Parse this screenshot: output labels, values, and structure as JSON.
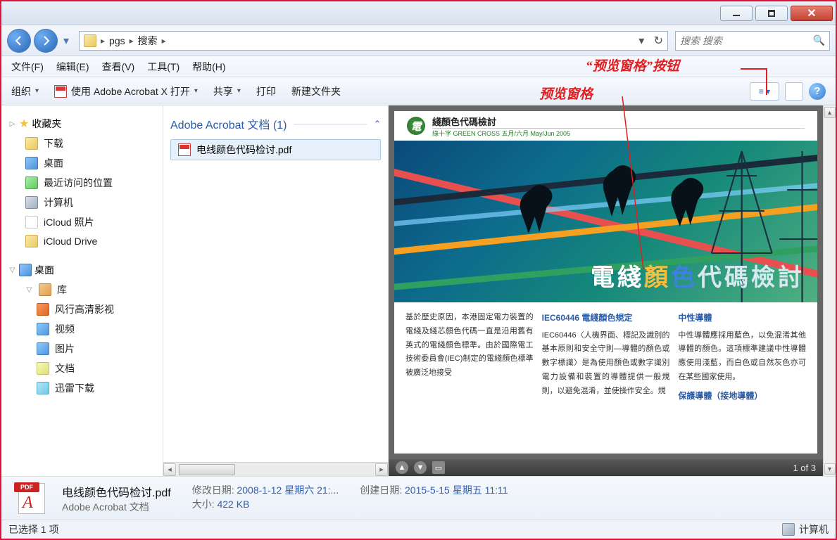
{
  "window_controls": {
    "minimize": "–",
    "maximize": "□",
    "close": "X"
  },
  "address": {
    "segments": [
      "pgs",
      "搜索"
    ]
  },
  "search": {
    "placeholder": "搜索 搜索"
  },
  "menubar": [
    "文件(F)",
    "编辑(E)",
    "查看(V)",
    "工具(T)",
    "帮助(H)"
  ],
  "toolbar": {
    "organize": "组织",
    "open_with": "使用 Adobe Acrobat X 打开",
    "share": "共享",
    "print": "打印",
    "new_folder": "新建文件夹"
  },
  "sidebar": {
    "favorites": {
      "label": "收藏夹",
      "items": [
        {
          "label": "下载",
          "icon": "folder"
        },
        {
          "label": "桌面",
          "icon": "monitor"
        },
        {
          "label": "最近访问的位置",
          "icon": "places"
        },
        {
          "label": "计算机",
          "icon": "computer"
        },
        {
          "label": "iCloud 照片",
          "icon": "blank-icon"
        },
        {
          "label": "iCloud Drive",
          "icon": "folder"
        }
      ]
    },
    "desktop": {
      "label": "桌面",
      "library": {
        "label": "库",
        "items": [
          {
            "label": "风行高清影视",
            "icon": "vid"
          },
          {
            "label": "视频",
            "icon": "pic"
          },
          {
            "label": "图片",
            "icon": "pic"
          },
          {
            "label": "文档",
            "icon": "doc"
          },
          {
            "label": "迅雷下载",
            "icon": "dl"
          }
        ]
      }
    }
  },
  "filelist": {
    "group_label": "Adobe Acrobat 文档 (1)",
    "items": [
      {
        "name": "电线颜色代码检讨.pdf"
      }
    ]
  },
  "preview": {
    "doc_header_title": "綫顏色代碼檢討",
    "doc_header_sub": "綠十字  GREEN CROSS  五月/六月  May/Jun 2005",
    "hero_title_parts": [
      "電綫",
      "顏",
      "色",
      "代碼檢討"
    ],
    "col1_text": "基於歷史原因，本港固定電力裝置的電綫及綫芯顏色代碼一直是沿用舊有英式的電綫顏色標準。由於國際電工技術委員會(IEC)制定的電綫顏色標準被廣泛地接受",
    "col2_heading": "IEC60446 電綫顏色規定",
    "col2_text": "IEC60446〈人機界面、標記及識別的基本原則和安全守則—導體的顏色或數字標識〉是為使用顏色或數字識別電力設備和裝置的導體提供一般規則，以避免混淆，並使操作安全。規",
    "col3_heading": "中性導體",
    "col3_text": "中性導體應採用藍色，以免混淆其他導體的顏色。這項標準建議中性導體應使用淺藍，而白色或自然灰色亦可在某些國家使用。",
    "col3_heading2": "保護導體（接地導體）",
    "page_indicator": "1 of 3"
  },
  "details": {
    "filename": "电线颜色代码检讨.pdf",
    "filetype": "Adobe Acrobat 文档",
    "modified_label": "修改日期:",
    "modified_value": "2008-1-12 星期六 21:...",
    "created_label": "创建日期:",
    "created_value": "2015-5-15 星期五 11:11",
    "size_label": "大小:",
    "size_value": "422 KB",
    "pdf_badge": "PDF"
  },
  "statusbar": {
    "left": "已选择 1 项",
    "right": "计算机"
  },
  "annotations": {
    "preview_pane": "预览窗格",
    "preview_button": "“预览窗格”按钮"
  }
}
